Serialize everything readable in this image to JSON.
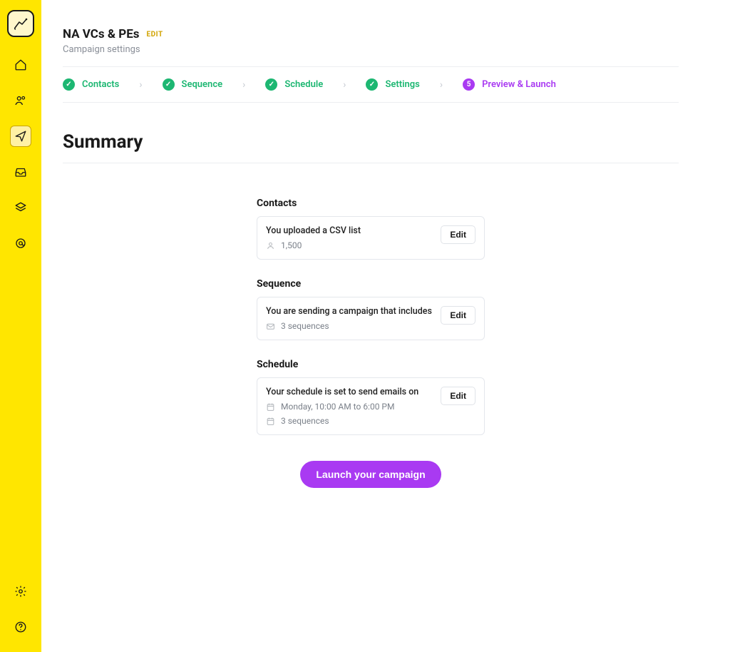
{
  "campaign": {
    "title": "NA VCs & PEs",
    "edit_label": "EDIT",
    "subtitle": "Campaign settings"
  },
  "steps": {
    "contacts": "Contacts",
    "sequence": "Sequence",
    "schedule": "Schedule",
    "settings": "Settings",
    "preview": "Preview & Launch",
    "preview_num": "5"
  },
  "summary": {
    "heading": "Summary",
    "contacts": {
      "title": "Contacts",
      "line": "You uploaded a CSV list",
      "count": "1,500",
      "edit": "Edit"
    },
    "sequence": {
      "title": "Sequence",
      "line": "You are sending a campaign that includes",
      "count": "3 sequences",
      "edit": "Edit"
    },
    "schedule": {
      "title": "Schedule",
      "line": "Your schedule is set to send emails on",
      "time": "Monday, 10:00 AM to 6:00 PM",
      "count": "3 sequences",
      "edit": "Edit"
    }
  },
  "launch_label": "Launch  your campaign"
}
